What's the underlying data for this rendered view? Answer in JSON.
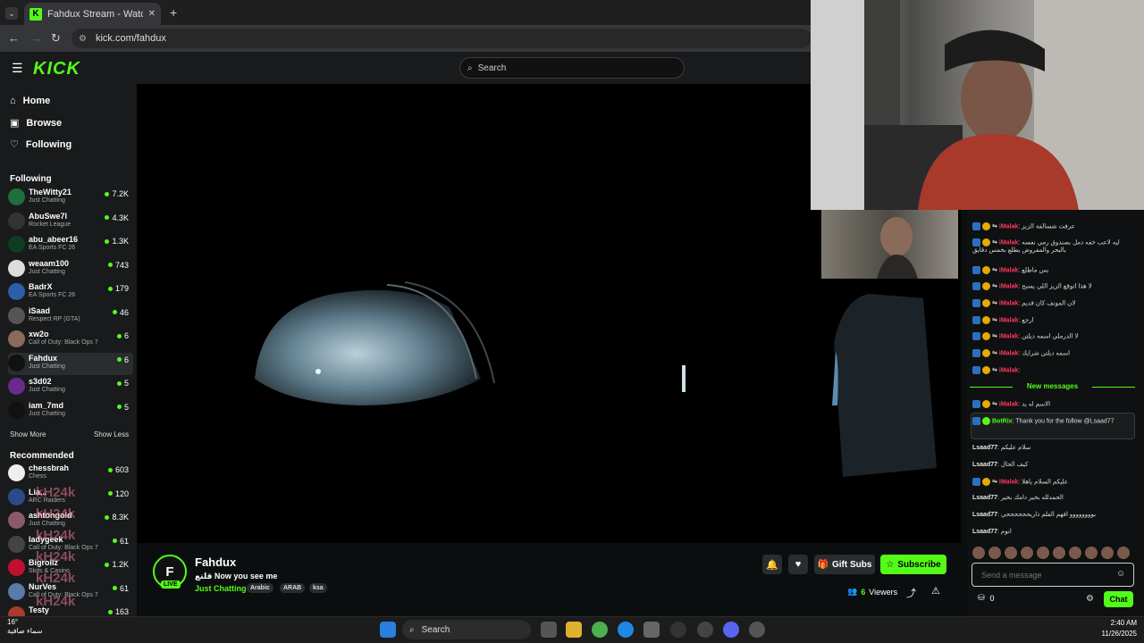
{
  "browser": {
    "tab_title": "Fahdux Stream - Watch Live",
    "url": "kick.com/fahdux"
  },
  "header": {
    "logo_text": "KICK",
    "search_placeholder": "Search"
  },
  "nav": {
    "home": "Home",
    "browse": "Browse",
    "following": "Following"
  },
  "sidebar": {
    "following_title": "Following",
    "following": [
      {
        "name": "TheWitty21",
        "category": "Just Chatting",
        "viewers": "7.2K",
        "color": "#1f6f3a"
      },
      {
        "name": "AbuSwe7l",
        "category": "Rocket League",
        "viewers": "4.3K",
        "color": "#333"
      },
      {
        "name": "abu_abeer16",
        "category": "EA Sports FC 26",
        "viewers": "1.3K",
        "color": "#0f3d1f"
      },
      {
        "name": "weaam100",
        "category": "Just Chatting",
        "viewers": "743",
        "color": "#ddd"
      },
      {
        "name": "BadrX",
        "category": "EA Sports FC 26",
        "viewers": "179",
        "color": "#2d5fa8"
      },
      {
        "name": "iSaad",
        "category": "Respect RP (GTA)",
        "viewers": "46",
        "color": "#555"
      },
      {
        "name": "xw2o",
        "category": "Call of Duty: Black Ops 7",
        "viewers": "6",
        "color": "#8a6a5a"
      },
      {
        "name": "Fahdux",
        "category": "Just Chatting",
        "viewers": "6",
        "color": "#111"
      },
      {
        "name": "s3d02",
        "category": "Just Chatting",
        "viewers": "5",
        "color": "#6a2a8a"
      },
      {
        "name": "iam_7md",
        "category": "Just Chatting",
        "viewers": "5",
        "color": "#111"
      }
    ],
    "show_more": "Show More",
    "show_less": "Show Less",
    "recommended_title": "Recommended",
    "recommended": [
      {
        "name": "chessbrah",
        "category": "Chess",
        "viewers": "603",
        "color": "#eee"
      },
      {
        "name": "Lia...",
        "category": "ARC Raiders",
        "viewers": "120",
        "color": "#2a4a8a"
      },
      {
        "name": "ashtongold",
        "category": "Just Chatting",
        "viewers": "8.3K",
        "color": "#8a5a6a"
      },
      {
        "name": "ladygeek",
        "category": "Call of Duty: Black Ops 7",
        "viewers": "61",
        "color": "#444"
      },
      {
        "name": "Bigrollz",
        "category": "Slots & Casino",
        "viewers": "1.2K",
        "color": "#c01030"
      },
      {
        "name": "NurVes",
        "category": "Call of Duty: Black Ops 7",
        "viewers": "61",
        "color": "#5a7aaa"
      },
      {
        "name": "Testy",
        "category": "",
        "viewers": "163",
        "color": "#aa3a2a"
      }
    ],
    "watermark": "kH24k"
  },
  "stream": {
    "channel": "Fahdux",
    "avatar_letter": "F",
    "live": "LIVE",
    "title": "قلتع Now you see me",
    "category": "Just Chatting",
    "tags": [
      "Arabic",
      "ARAB",
      "ksa"
    ],
    "gift_subs": "Gift Subs",
    "subscribe": "Subscribe",
    "viewers_count": "6",
    "viewers_label": "Viewers"
  },
  "chat": {
    "messages": [
      {
        "user": "iMalak",
        "text": "عرفت شسالفة الزيز",
        "badges": true
      },
      {
        "user": "iMalak",
        "text": "ليه لاعب خفه دمل بصندوق رمي نفسه بالبحر والمفروض يطلع بخمس دقايق",
        "badges": true
      },
      {
        "user": "iMalak",
        "text": "بس ماطلع",
        "badges": true
      },
      {
        "user": "iMalak",
        "text": "لا هذا اتوقع الزيز اللي يسبح",
        "badges": true
      },
      {
        "user": "iMalak",
        "text": "لان المونف كان قديم",
        "badges": true
      },
      {
        "user": "iMalak",
        "text": "ارجع",
        "badges": true
      },
      {
        "user": "iMalak",
        "text": "لا الدرملي اسمه ديلتن",
        "badges": true
      },
      {
        "user": "iMalak",
        "text": "اسمه ديلتن شرايك",
        "badges": true
      },
      {
        "user": "iMalak",
        "text": "",
        "badges": true
      }
    ],
    "new_messages_label": "New messages",
    "after": [
      {
        "user": "iMalak",
        "text": "الاسم له يد",
        "badges": true
      }
    ],
    "bot": {
      "user": "BotRix",
      "text": "Thank you for the follow @Lsaad77"
    },
    "later": [
      {
        "user": "Lsaad77",
        "text": "سلام عليكم",
        "badges": false
      },
      {
        "user": "Lsaad77",
        "text": "كيف الحال",
        "badges": false
      },
      {
        "user": "iMalak",
        "text": "عليكم السلام ياهلا",
        "badges": true
      },
      {
        "user": "Lsaad77",
        "text": "الحمدلله بخير دامك بخير",
        "badges": false
      },
      {
        "user": "Lsaad77",
        "text": "بوووووووو افهم الفلم ذاريححححححي",
        "badges": false
      },
      {
        "user": "Lsaad77",
        "text": "انوم",
        "badges": false
      }
    ],
    "input_placeholder": "Send a message",
    "points": "0",
    "chat_button": "Chat"
  },
  "taskbar": {
    "search": "Search",
    "time": "2:40 AM",
    "date": "11/26/2025",
    "weather_temp": "16°",
    "weather_desc": "سماء صافية"
  }
}
